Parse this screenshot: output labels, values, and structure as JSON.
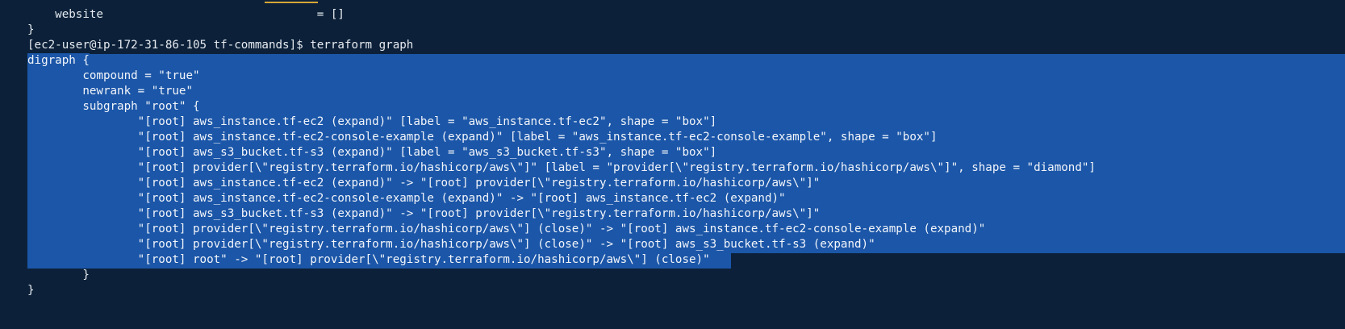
{
  "terminal": {
    "lines": [
      "    website                               = []",
      "}",
      "[ec2-user@ip-172-31-86-105 tf-commands]$ terraform graph",
      "digraph {",
      "        compound = \"true\"",
      "        newrank = \"true\"",
      "        subgraph \"root\" {",
      "                \"[root] aws_instance.tf-ec2 (expand)\" [label = \"aws_instance.tf-ec2\", shape = \"box\"]",
      "                \"[root] aws_instance.tf-ec2-console-example (expand)\" [label = \"aws_instance.tf-ec2-console-example\", shape = \"box\"]",
      "                \"[root] aws_s3_bucket.tf-s3 (expand)\" [label = \"aws_s3_bucket.tf-s3\", shape = \"box\"]",
      "                \"[root] provider[\\\"registry.terraform.io/hashicorp/aws\\\"]\" [label = \"provider[\\\"registry.terraform.io/hashicorp/aws\\\"]\", shape = \"diamond\"]",
      "                \"[root] aws_instance.tf-ec2 (expand)\" -> \"[root] provider[\\\"registry.terraform.io/hashicorp/aws\\\"]\"",
      "                \"[root] aws_instance.tf-ec2-console-example (expand)\" -> \"[root] aws_instance.tf-ec2 (expand)\"",
      "                \"[root] aws_s3_bucket.tf-s3 (expand)\" -> \"[root] provider[\\\"registry.terraform.io/hashicorp/aws\\\"]\"",
      "                \"[root] provider[\\\"registry.terraform.io/hashicorp/aws\\\"] (close)\" -> \"[root] aws_instance.tf-ec2-console-example (expand)\"",
      "                \"[root] provider[\\\"registry.terraform.io/hashicorp/aws\\\"] (close)\" -> \"[root] aws_s3_bucket.tf-s3 (expand)\"",
      "                \"[root] root\" -> \"[root] provider[\\\"registry.terraform.io/hashicorp/aws\\\"] (close)\"",
      "        }",
      "}"
    ]
  },
  "colors": {
    "background": "#0c2139",
    "selection": "#1b56a8",
    "text": "#e6eaf0",
    "underline": "#d8a736"
  }
}
